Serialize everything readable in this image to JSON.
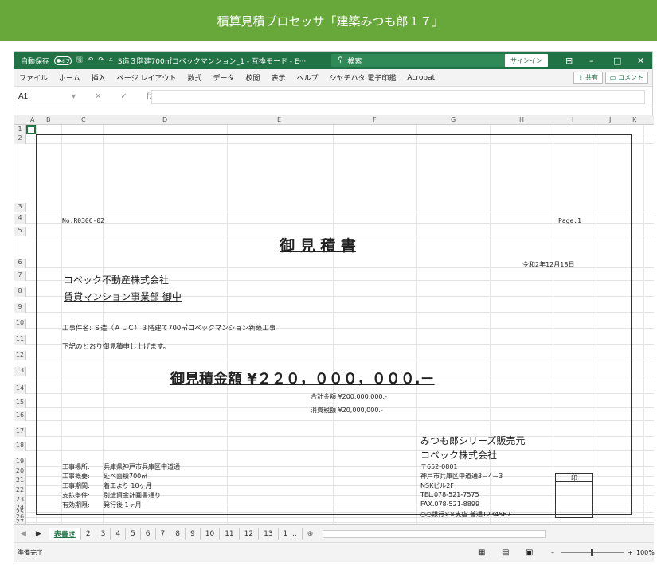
{
  "banner": {
    "title": "積算見積プロセッサ「建築みつも郎１７」"
  },
  "titlebar": {
    "autosave": "自動保存",
    "toggle": "オフ",
    "doc_title": "S造３階建700㎡コベックマンション_1  -  互換モード  -  E···",
    "search": "検索",
    "signin": "サインイン"
  },
  "menu": {
    "items": [
      "ファイル",
      "ホーム",
      "挿入",
      "ページ レイアウト",
      "数式",
      "データ",
      "校閲",
      "表示",
      "ヘルプ",
      "シヤチハタ 電子印鑑",
      "Acrobat"
    ],
    "share": "共有",
    "comment": "コメント"
  },
  "formula": {
    "namebox": "A1",
    "fx": "fx"
  },
  "columns": [
    "A",
    "B",
    "C",
    "D",
    "E",
    "F",
    "G",
    "H",
    "I",
    "J",
    "K"
  ],
  "rows": [
    "1",
    "2",
    "3",
    "4",
    "5",
    "6",
    "7",
    "8",
    "9",
    "10",
    "11",
    "12",
    "13",
    "14",
    "15",
    "16",
    "17",
    "18",
    "19",
    "20",
    "21",
    "22",
    "23",
    "24",
    "25",
    "26",
    "27",
    "28",
    "29"
  ],
  "doc": {
    "no": "No.R0306-02",
    "page": "Page.1",
    "heading": "御 見 積 書",
    "date": "令和2年12月18日",
    "client1": "コベック不動産株式会社",
    "client2": "賃貸マンション事業部 御中",
    "project": "工事件名:  Ｓ造（ＡＬＣ）３階建て700㎡コベックマンション新築工事",
    "intro": "下記のとおり御見積申し上げます。",
    "total": "御見積金額 ¥２２０，０００，０００.－",
    "subtotal": "合計金額 ¥200,000,000.-",
    "tax": "消費税額 ¥20,000,000.-",
    "seller1": "みつも郎シリーズ販売元",
    "seller2": "コベック株式会社",
    "zip": "〒652-0801",
    "address": "神戸市兵庫区中道通3－4－3",
    "building": "NSKビル2F",
    "tel": "TEL.078-521-7575",
    "fax": "FAX.078-521-8899",
    "bank": "○○銀行××支店  普通1234567",
    "stamp": "印",
    "details": [
      {
        "label": "工事場所:",
        "value": "兵庫県神戸市兵庫区中道通"
      },
      {
        "label": "工事概要:",
        "value": "延べ面積700㎡"
      },
      {
        "label": "工事期間:",
        "value": "着工より  10ヶ月"
      },
      {
        "label": "支払条件:",
        "value": "別途資金計画書通り"
      },
      {
        "label": "有効期限:",
        "value": "発行後  1ヶ月"
      }
    ]
  },
  "sheets": [
    "表書き",
    "2",
    "3",
    "4",
    "5",
    "6",
    "7",
    "8",
    "9",
    "10",
    "11",
    "12",
    "13",
    "1 ..."
  ],
  "status": {
    "ready": "準備完了",
    "zoom": "100%"
  }
}
